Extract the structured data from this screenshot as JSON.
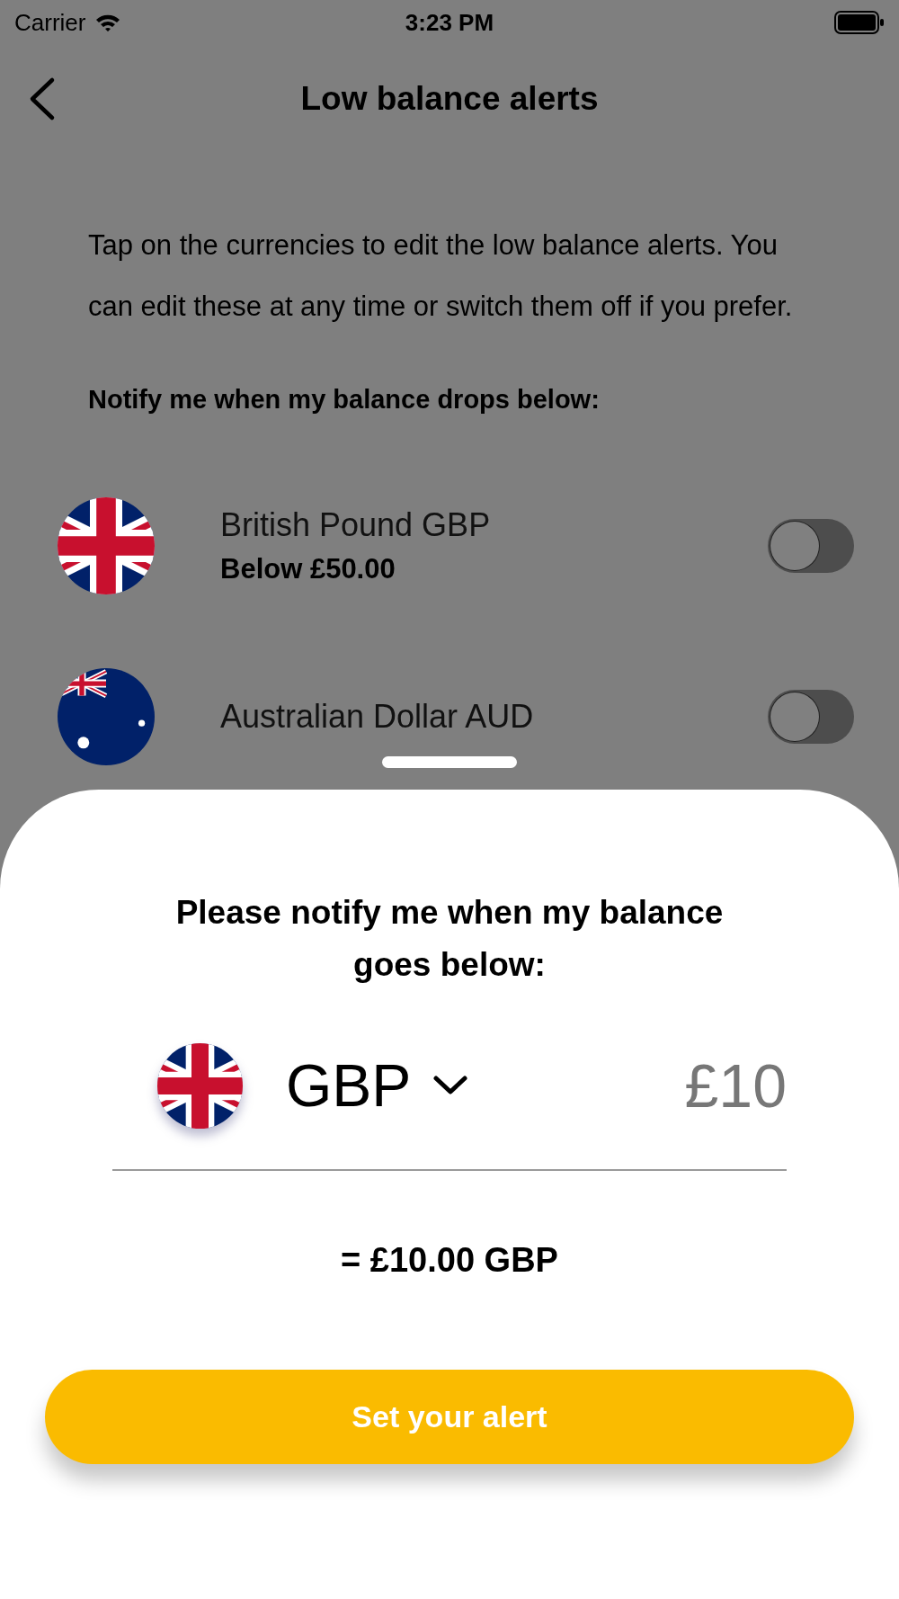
{
  "status_bar": {
    "carrier": "Carrier",
    "time": "3:23 PM"
  },
  "header": {
    "title": "Low balance alerts"
  },
  "intro": "Tap on the currencies to edit the low balance alerts. You can edit these at any time or switch them off if you prefer.",
  "prompt": "Notify me when my balance drops below:",
  "currencies": [
    {
      "name": "British Pound GBP",
      "alert": "Below £50.00",
      "on": false,
      "kind": "gb"
    },
    {
      "name": "Australian Dollar AUD",
      "on": false,
      "kind": "au"
    }
  ],
  "sheet": {
    "title": "Please notify me when my balance goes below:",
    "currency": "GBP",
    "kind": "gb",
    "amount": {
      "placeholder": "£10"
    },
    "converted": "= £10.00 GBP",
    "button": "Set your alert"
  }
}
